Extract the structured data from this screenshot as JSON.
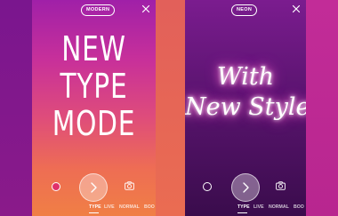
{
  "left_screen": {
    "style_label": "MODERN",
    "headline": [
      "NEW",
      "TYPE",
      "MODE"
    ],
    "selected_color": "#e0306a",
    "modes": [
      "TYPE",
      "LIVE",
      "NORMAL",
      "BOO"
    ]
  },
  "right_screen": {
    "style_label": "NEON",
    "headline": [
      "With",
      "New Styles"
    ],
    "modes": [
      "TYPE",
      "LIVE",
      "NORMAL",
      "BOO"
    ]
  },
  "icons": {
    "close": "close-icon",
    "shutter": "chevron-right-icon",
    "camera": "camera-icon"
  },
  "colors": {
    "left_gradient_top": "#a020a8",
    "left_gradient_bottom": "#f07f45",
    "right_gradient_top": "#7b1c8f",
    "right_gradient_bottom": "#3a0c4c",
    "neon_glow": "#ff4fc4"
  }
}
